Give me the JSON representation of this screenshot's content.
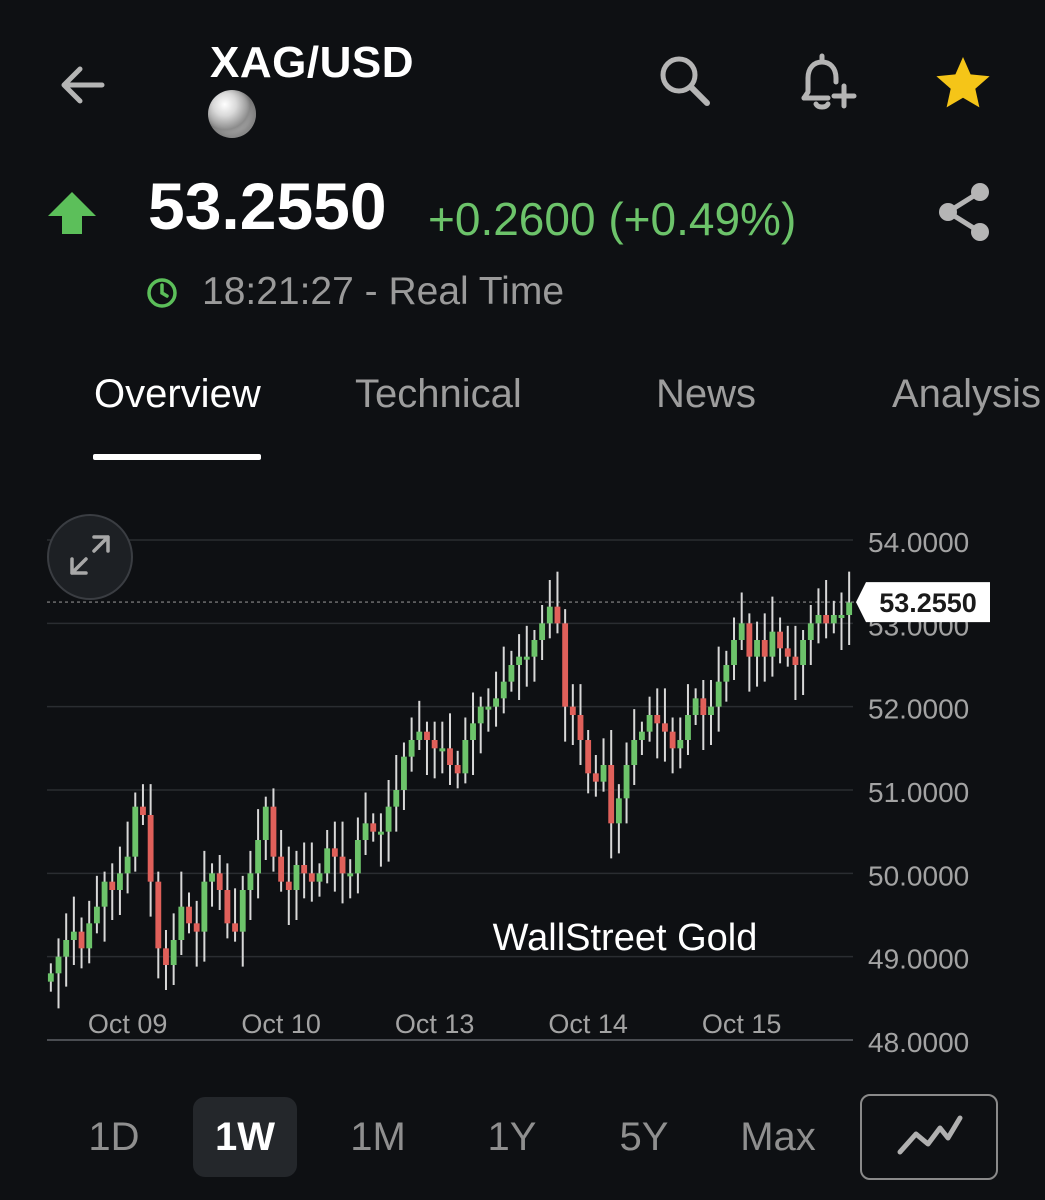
{
  "header": {
    "title": "XAG/USD",
    "back_icon": "arrow-left-icon",
    "search_icon": "search-icon",
    "alert_icon": "bell-plus-icon",
    "favorite_icon": "star-icon",
    "favorite_color": "#f5c518"
  },
  "quote": {
    "price": "53.2550",
    "change": "+0.2600 (+0.49%)",
    "direction_icon": "arrow-up-icon",
    "up_color": "#5cbf5a",
    "time": "18:21:27 - Real Time"
  },
  "tabs": [
    {
      "label": "Overview",
      "active": true
    },
    {
      "label": "Technical",
      "active": false
    },
    {
      "label": "News",
      "active": false
    },
    {
      "label": "Analysis",
      "active": false
    }
  ],
  "chart_data": {
    "type": "candlestick",
    "watermark": "WallStreet Gold",
    "current_price_label": "53.2550",
    "current_price": 53.255,
    "ylim": [
      48,
      54
    ],
    "yticks": [
      "54.0000",
      "53.0000",
      "52.0000",
      "51.0000",
      "50.0000",
      "49.0000",
      "48.0000"
    ],
    "xticks": [
      {
        "label": "Oct 09",
        "index": 10
      },
      {
        "label": "Oct 10",
        "index": 30
      },
      {
        "label": "Oct 13",
        "index": 50
      },
      {
        "label": "Oct 14",
        "index": 70
      },
      {
        "label": "Oct 15",
        "index": 90
      }
    ],
    "up_color": "#6cc36a",
    "down_color": "#e0605a",
    "closes": [
      48.8,
      49.0,
      49.2,
      49.3,
      49.1,
      49.4,
      49.6,
      49.9,
      49.8,
      50.0,
      50.2,
      50.8,
      50.7,
      49.9,
      49.1,
      48.9,
      49.2,
      49.6,
      49.4,
      49.3,
      49.9,
      50.0,
      49.8,
      49.4,
      49.3,
      49.8,
      50.0,
      50.4,
      50.8,
      50.2,
      49.9,
      49.8,
      50.1,
      50.0,
      49.9,
      50.0,
      50.3,
      50.2,
      50.0,
      50.0,
      50.4,
      50.6,
      50.5,
      50.5,
      50.8,
      51.0,
      51.4,
      51.6,
      51.7,
      51.6,
      51.5,
      51.5,
      51.3,
      51.2,
      51.6,
      51.8,
      52.0,
      52.0,
      52.1,
      52.3,
      52.5,
      52.6,
      52.6,
      52.8,
      53.0,
      53.2,
      53.0,
      52.0,
      51.9,
      51.6,
      51.2,
      51.1,
      51.3,
      50.6,
      50.9,
      51.3,
      51.6,
      51.7,
      51.9,
      51.8,
      51.7,
      51.5,
      51.6,
      51.9,
      52.1,
      51.9,
      52.0,
      52.3,
      52.5,
      52.8,
      53.0,
      52.6,
      52.8,
      52.6,
      52.9,
      52.7,
      52.6,
      52.5,
      52.8,
      53.0,
      53.1,
      53.0,
      53.1,
      53.1,
      53.25
    ]
  },
  "ranges": [
    "1D",
    "1W",
    "1M",
    "1Y",
    "5Y",
    "Max"
  ],
  "selected_range": "1W",
  "chart_type_icon": "line-chart-icon",
  "expand_icon": "expand-icon",
  "share_icon": "share-icon",
  "clock_icon": "clock-icon"
}
